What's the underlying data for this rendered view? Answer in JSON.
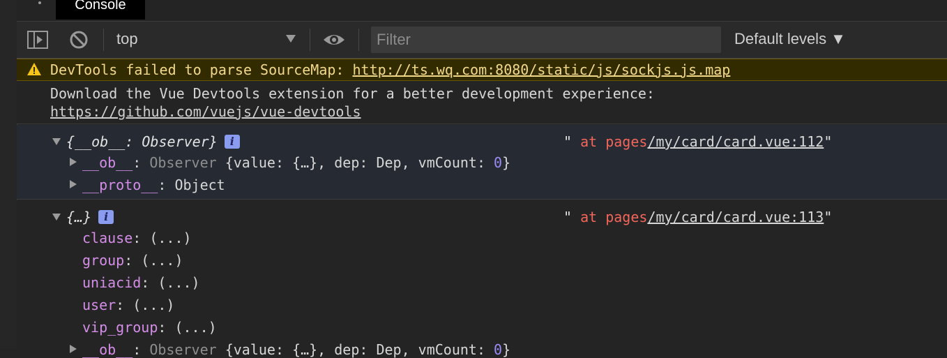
{
  "tabs": {
    "console_label": "Console"
  },
  "toolbar": {
    "context_value": "top",
    "filter_placeholder": "Filter",
    "levels_label": "Default levels ▼"
  },
  "colors": {
    "warning_bg": "#332b00",
    "warning_text": "#f2d98a",
    "badge": "#8a9cf0",
    "key": "#d48ee8",
    "red_source": "#f2665b"
  },
  "icons": [
    "kebab-icon",
    "sidebar-toggle-icon",
    "clear-console-icon",
    "eye-icon",
    "warning-icon",
    "info-icon",
    "expand-triangle-icon"
  ],
  "messages": {
    "warning": {
      "text": "DevTools failed to parse SourceMap: ",
      "link": "http://ts.wq.com:8080/static/js/sockjs.js.map"
    },
    "info": {
      "line1": "Download the Vue Devtools extension for a better development experience:",
      "line2": "https://github.com/vuejs/vue-devtools"
    },
    "log1": {
      "summary": "{__ob__: Observer}",
      "badge": "i",
      "src_quote_open": "\"",
      "src_at": " at ",
      "src_pages": "pages",
      "src_file": "/my/card/card.vue:112",
      "src_quote_close": "\"",
      "row1_key": "__ob__",
      "row1_colon": ": ",
      "row1_type": "Observer",
      "row1_rest_a": " {value: {…}, dep: Dep, vmCount: ",
      "row1_num": "0",
      "row1_rest_b": "}",
      "row2_key": "__proto__",
      "row2_val": ": Object"
    },
    "log2": {
      "summary": "{…}",
      "badge": "i",
      "src_quote_open": "\"",
      "src_at": " at ",
      "src_pages": "pages",
      "src_file": "/my/card/card.vue:113",
      "src_quote_close": "\"",
      "props": [
        {
          "key": "clause",
          "val": ": (...)"
        },
        {
          "key": "group",
          "val": ": (...)"
        },
        {
          "key": "uniacid",
          "val": ": (...)"
        },
        {
          "key": "user",
          "val": ": (...)"
        },
        {
          "key": "vip_group",
          "val": ": (...)"
        }
      ],
      "row_ob_key": "__ob__",
      "row_ob_colon": ": ",
      "row_ob_type": "Observer",
      "row_ob_rest_a": " {value: {…}, dep: Dep, vmCount: ",
      "row_ob_num": "0",
      "row_ob_rest_b": "}"
    }
  }
}
